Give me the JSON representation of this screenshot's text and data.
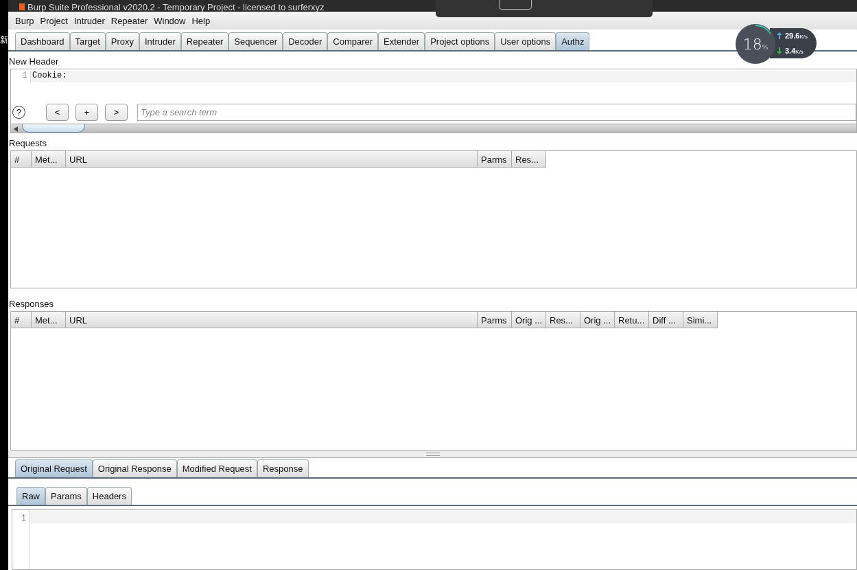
{
  "window": {
    "title": "Burp Suite Professional v2020.2 - Temporary Project - licensed to surferxyz"
  },
  "side_text": "新",
  "menu": [
    "Burp",
    "Project",
    "Intruder",
    "Repeater",
    "Window",
    "Help"
  ],
  "tabs": [
    {
      "label": "Dashboard",
      "selected": false
    },
    {
      "label": "Target",
      "selected": false
    },
    {
      "label": "Proxy",
      "selected": false
    },
    {
      "label": "Intruder",
      "selected": false
    },
    {
      "label": "Repeater",
      "selected": false
    },
    {
      "label": "Sequencer",
      "selected": false
    },
    {
      "label": "Decoder",
      "selected": false
    },
    {
      "label": "Comparer",
      "selected": false
    },
    {
      "label": "Extender",
      "selected": false
    },
    {
      "label": "Project options",
      "selected": false
    },
    {
      "label": "User options",
      "selected": false
    },
    {
      "label": "Authz",
      "selected": true
    }
  ],
  "new_header": {
    "label": "New Header",
    "lines": [
      {
        "number": "1",
        "text": "Cookie:"
      }
    ],
    "search": {
      "placeholder": "Type a search term"
    },
    "buttons": [
      "<",
      "+",
      ">"
    ],
    "help": "?"
  },
  "requests": {
    "label": "Requests",
    "columns": [
      "#",
      "Met...",
      "URL",
      "Parms",
      "Res..."
    ]
  },
  "responses": {
    "label": "Responses",
    "columns": [
      "#",
      "Met...",
      "URL",
      "Parms",
      "Orig ...",
      "Res...",
      "Orig ...",
      "Retu...",
      "Diff ...",
      "Simi..."
    ]
  },
  "detail_tabs": [
    {
      "label": "Original Request",
      "selected": true
    },
    {
      "label": "Original Response",
      "selected": false
    },
    {
      "label": "Modified Request",
      "selected": false
    },
    {
      "label": "Response",
      "selected": false
    }
  ],
  "view_tabs": [
    {
      "label": "Raw",
      "selected": true
    },
    {
      "label": "Params",
      "selected": false
    },
    {
      "label": "Headers",
      "selected": false
    }
  ],
  "editor": {
    "line_numbers": [
      "1"
    ]
  },
  "network_widget": {
    "cpu": "18",
    "cpu_unit": "%",
    "upload": "29.6",
    "upload_unit": "K/s",
    "download": "3.4",
    "download_unit": "K/s"
  }
}
